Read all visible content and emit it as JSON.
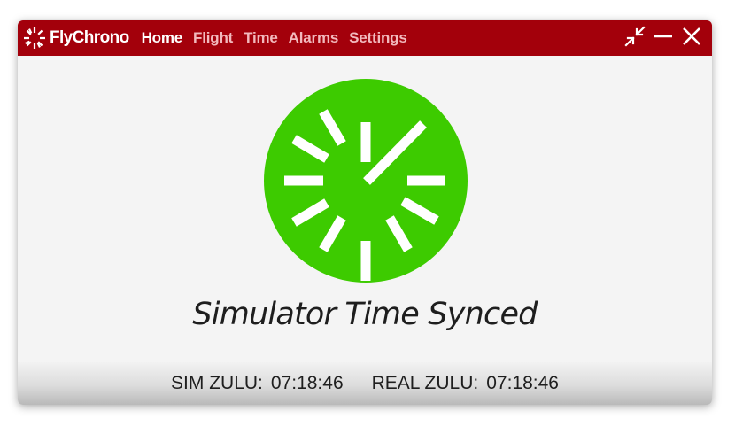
{
  "app": {
    "name": "FlyChrono",
    "brand_color": "#a3000b",
    "logo_icon": "sunburst-icon"
  },
  "nav": {
    "items": [
      {
        "label": "Home",
        "active": true
      },
      {
        "label": "Flight",
        "active": false
      },
      {
        "label": "Time",
        "active": false
      },
      {
        "label": "Alarms",
        "active": false
      },
      {
        "label": "Settings",
        "active": false
      }
    ]
  },
  "window_controls": {
    "compact_icon": "shrink-arrows-icon",
    "minimize_icon": "minimize-icon",
    "close_icon": "close-icon"
  },
  "main": {
    "status_text": "Simulator Time Synced",
    "status_color": "#3dcb00",
    "status_icon": "clock-icon"
  },
  "footer": {
    "sim_label": "SIM ZULU:",
    "sim_value": "07:18:46",
    "real_label": "REAL ZULU:",
    "real_value": "07:18:46"
  }
}
